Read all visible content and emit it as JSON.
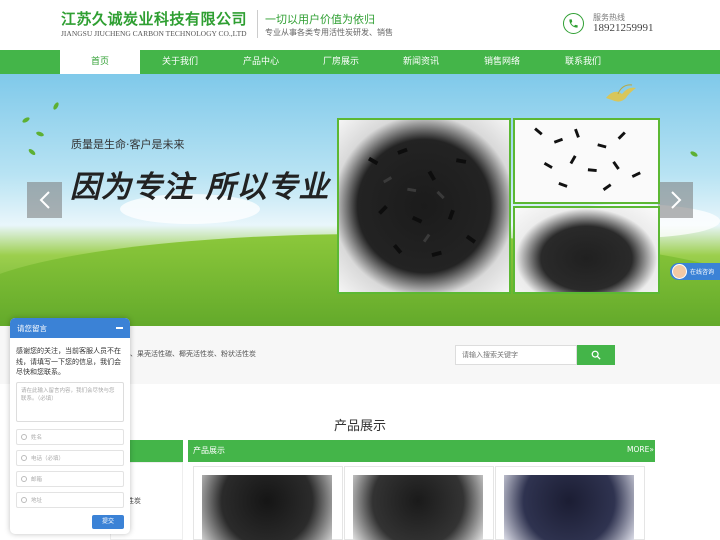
{
  "header": {
    "company_cn": "江苏久诚炭业科技有限公司",
    "company_en": "JIANGSU JIUCHENG CARBON TECHNOLOGY CO.,LTD",
    "slogan": "一切以用户价值为依归",
    "sub_slogan": "专业从事各类专用活性炭研发、销售",
    "hotline_label": "服务热线",
    "hotline_number": "18921259991",
    "brand_color": "#44b549"
  },
  "nav": {
    "items": [
      {
        "label": "首页",
        "active": true
      },
      {
        "label": "关于我们"
      },
      {
        "label": "产品中心"
      },
      {
        "label": "厂房展示"
      },
      {
        "label": "新闻资讯"
      },
      {
        "label": "销售网络"
      },
      {
        "label": "联系我们"
      }
    ]
  },
  "banner": {
    "tagline": "质量是生命·客户是未来",
    "title": "因为专注 所以专业",
    "prev_icon": "chevron-left-icon",
    "next_icon": "chevron-right-icon"
  },
  "chat_side": {
    "label": "在线咨询"
  },
  "search": {
    "keywords": "、果壳活性碳、椰壳活性炭、粉状活性炭",
    "placeholder": "请输入搜索关键字",
    "icon": "search-icon"
  },
  "products": {
    "section_title": "产品展示",
    "panel_title": "产品展示",
    "more": "MORE»",
    "sidebar_category": "性炭"
  },
  "chat_widget": {
    "title": "请您留言",
    "message": "感谢您的关注，当前客服人员不在线，请填写一下您的信息，我们会尽快和您联系。",
    "textarea_placeholder": "请在此输入留言内容，我们会尽快与您联系。（必填）",
    "fields": [
      {
        "placeholder": "姓名"
      },
      {
        "placeholder": "电话（必填）"
      },
      {
        "placeholder": "邮箱"
      },
      {
        "placeholder": "地址"
      }
    ],
    "submit": "提交",
    "accent": "#3b82d6"
  }
}
